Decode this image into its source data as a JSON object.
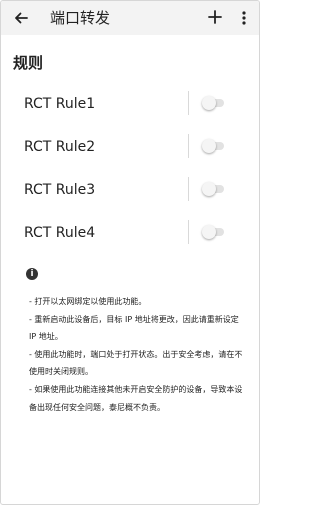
{
  "appbar": {
    "title": "端口转发",
    "back_icon": "arrow-left-icon",
    "add_icon": "plus-icon",
    "more_icon": "more-vertical-icon"
  },
  "section": {
    "title": "规则"
  },
  "rules": [
    {
      "label": "RCT Rule1",
      "enabled": false
    },
    {
      "label": "RCT Rule2",
      "enabled": false
    },
    {
      "label": "RCT Rule3",
      "enabled": false
    },
    {
      "label": "RCT Rule4",
      "enabled": false
    }
  ],
  "info": {
    "icon": "info-icon",
    "notes": [
      "- 打开以太网绑定以使用此功能。",
      "- 重新启动此设备后，目标 IP 地址将更改，因此请重新设定 IP 地址。",
      "- 使用此功能时，端口处于打开状态。出于安全考虑，请在不使用时关闭规则。",
      "- 如果使用此功能连接其他未开启安全防护的设备，导致本设备出现任何安全问题，泰尼概不负责。"
    ]
  }
}
